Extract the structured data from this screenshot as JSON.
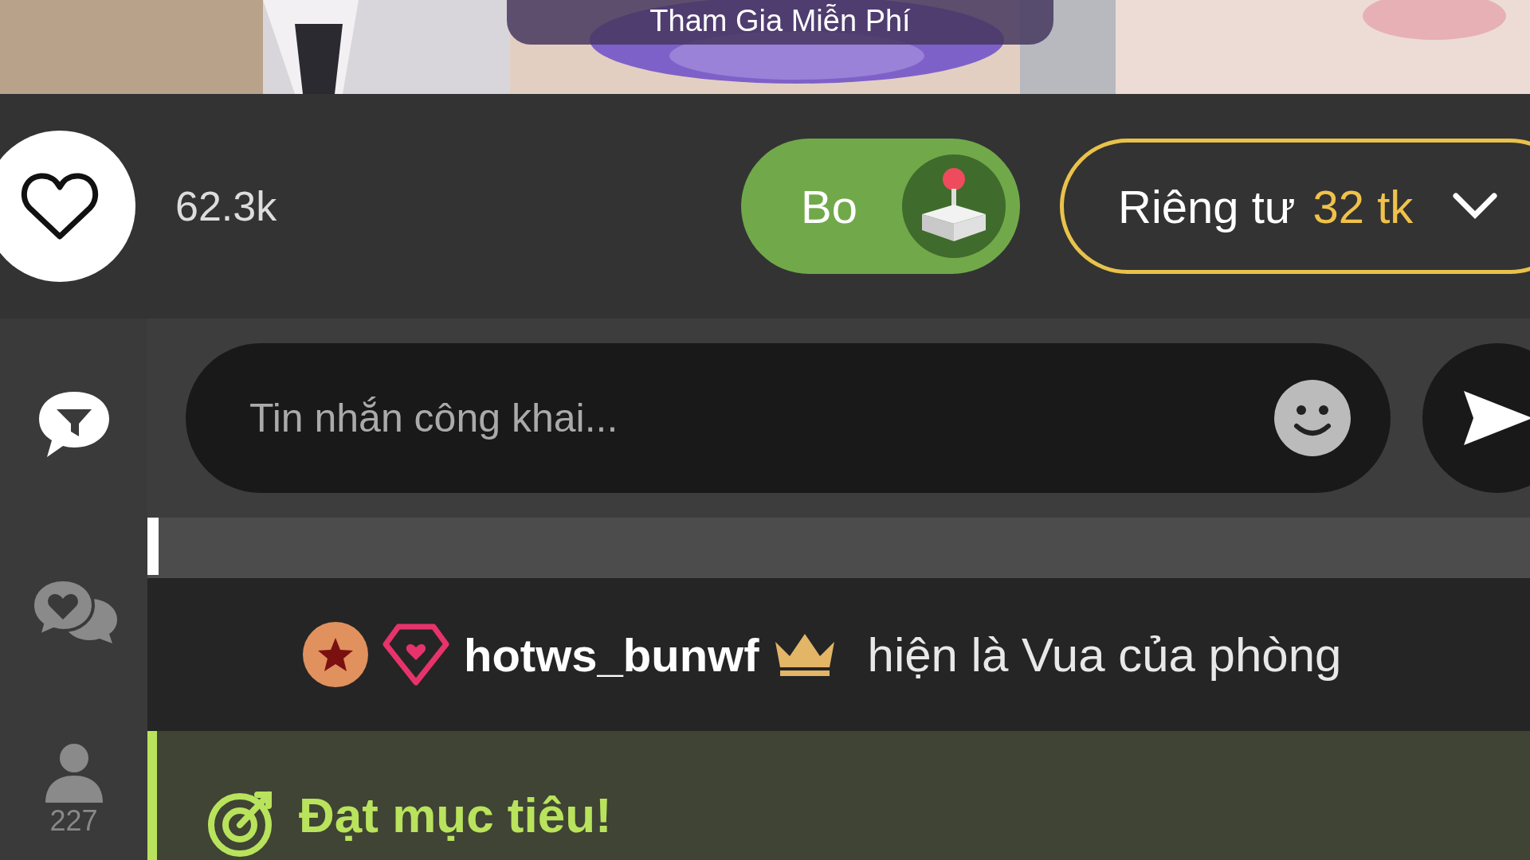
{
  "video": {
    "overlay_button": "Tham Gia Miễn Phí"
  },
  "likes": {
    "count": "62.3k"
  },
  "bo_toggle": {
    "label": "Bo",
    "on": true
  },
  "private_show": {
    "label": "Riêng tư",
    "price": "32 tk"
  },
  "chat_input": {
    "placeholder": "Tin nhắn công khai..."
  },
  "sidebar": {
    "items": [
      {
        "kind": "filter",
        "selected": true
      },
      {
        "kind": "private-chat",
        "selected": false
      },
      {
        "kind": "users",
        "count": "227",
        "selected": false
      }
    ]
  },
  "messages": [
    {
      "kind": "king",
      "username": "hotws_bunwf",
      "text": "hiện là Vua của phòng"
    },
    {
      "kind": "goal",
      "text": "Đạt mục tiêu!"
    }
  ]
}
